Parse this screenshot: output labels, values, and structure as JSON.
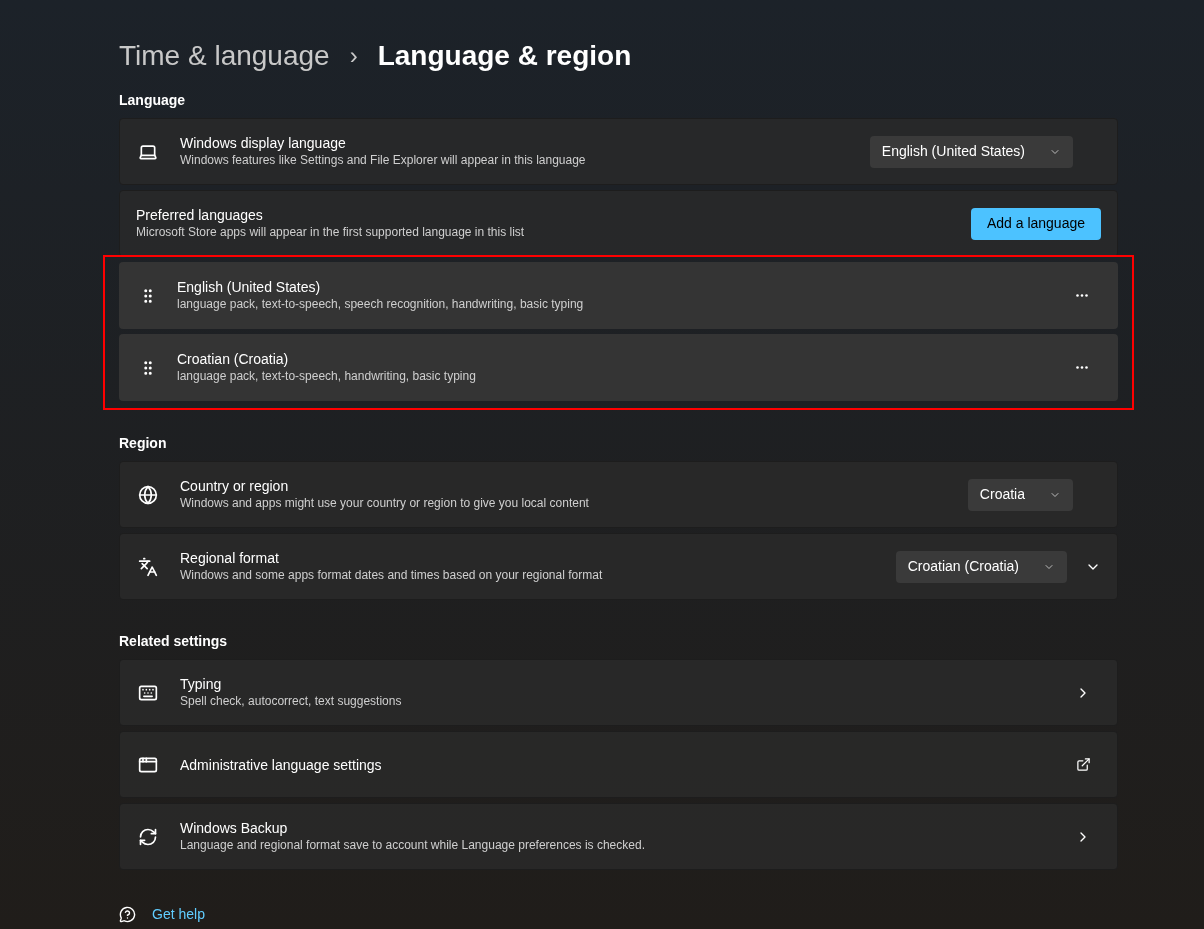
{
  "breadcrumb": {
    "parent": "Time & language",
    "separator": "›",
    "current": "Language & region"
  },
  "sections": [
    {
      "heading": "Language",
      "rows": [
        {
          "kind": "dropdown",
          "title": "Windows display language",
          "subtitle": "Windows features like Settings and File Explorer will appear in this language",
          "value": "English (United States)"
        },
        {
          "kind": "button",
          "title": "Preferred languages",
          "subtitle": "Microsoft Store apps will appear in the first supported language in this list",
          "button": "Add a language"
        }
      ],
      "languages": [
        {
          "title": "English (United States)",
          "subtitle": "language pack, text-to-speech, speech recognition, handwriting, basic typing"
        },
        {
          "title": "Croatian (Croatia)",
          "subtitle": "language pack, text-to-speech, handwriting, basic typing"
        }
      ]
    },
    {
      "heading": "Region",
      "rows": [
        {
          "kind": "dropdown",
          "title": "Country or region",
          "subtitle": "Windows and apps might use your country or region to give you local content",
          "value": "Croatia"
        },
        {
          "kind": "dropdown",
          "title": "Regional format",
          "subtitle": "Windows and some apps format dates and times based on your regional format",
          "value": "Croatian (Croatia)",
          "expanded": false
        }
      ]
    },
    {
      "heading": "Related settings",
      "rows": [
        {
          "kind": "link",
          "title": "Typing",
          "subtitle": "Spell check, autocorrect, text suggestions"
        },
        {
          "kind": "external",
          "title": "Administrative language settings"
        },
        {
          "kind": "link",
          "title": "Windows Backup",
          "subtitle": "Language and regional format save to account while Language preferences is checked."
        }
      ]
    }
  ],
  "help": {
    "label": "Get help"
  }
}
